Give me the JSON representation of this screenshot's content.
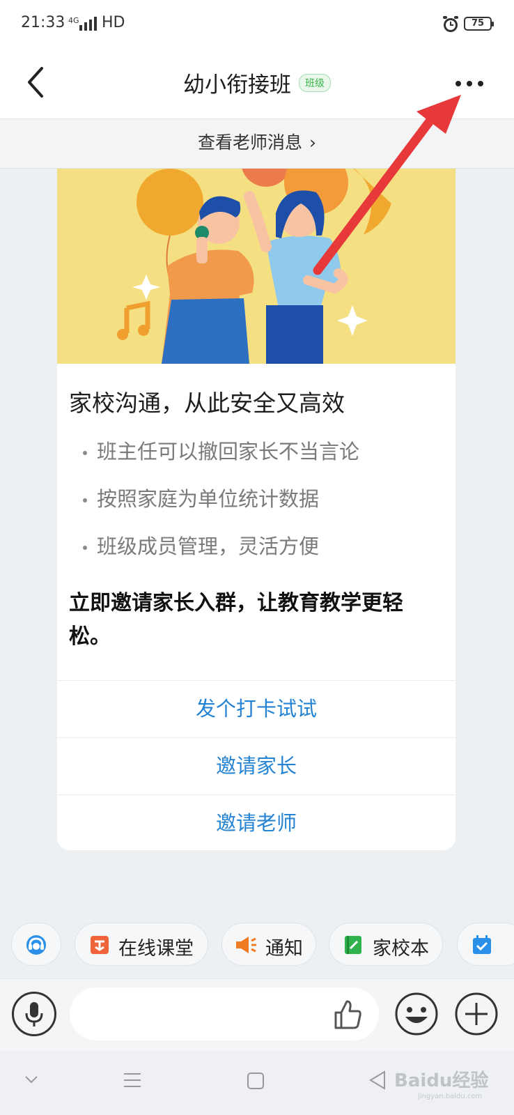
{
  "status_bar": {
    "time": "21:33",
    "network": "4G",
    "hd": "HD",
    "battery": "75"
  },
  "header": {
    "title": "幼小衔接班",
    "tag": "班级"
  },
  "teacher_bar": {
    "label": "查看老师消息",
    "chevron": "›"
  },
  "card": {
    "heading": "家校沟通，从此安全又高效",
    "bullets": [
      "班主任可以撤回家长不当言论",
      "按照家庭为单位统计数据",
      "班级成员管理，灵活方便"
    ],
    "cta": "立即邀请家长入群，让教育教学更轻松。",
    "actions": [
      "发个打卡试试",
      "邀请家长",
      "邀请老师"
    ]
  },
  "quick_bar": {
    "items": [
      "在线课堂",
      "通知",
      "家校本"
    ]
  },
  "input_bar": {
    "placeholder": ""
  },
  "watermark": {
    "brand": "Baidu经验",
    "url": "jingyan.baidu.com"
  },
  "colors": {
    "link": "#2583d4",
    "tag_green": "#3bb54a",
    "banner_yellow": "#f5df83",
    "arrow_red": "#e8393a"
  },
  "icons": [
    "back-arrow-icon",
    "more-icon",
    "headset-icon",
    "classroom-icon",
    "megaphone-icon",
    "notebook-icon",
    "calendar-check-icon",
    "mic-icon",
    "thumbs-up-icon",
    "emoji-icon",
    "plus-icon"
  ]
}
